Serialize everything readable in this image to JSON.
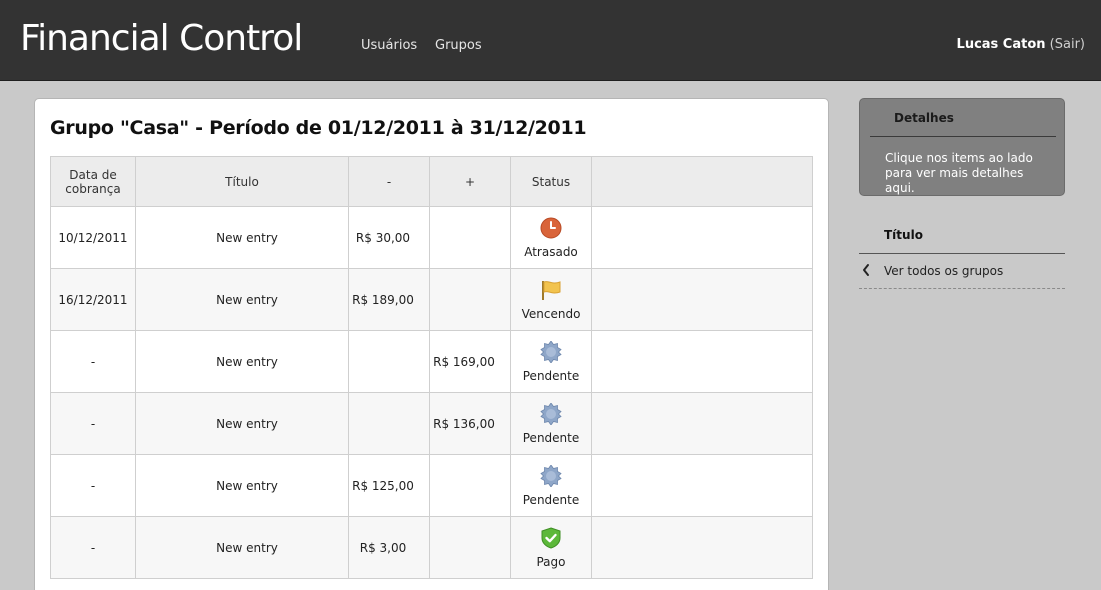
{
  "header": {
    "app_title": "Financial Control",
    "nav": [
      {
        "label": "Usuários"
      },
      {
        "label": "Grupos"
      }
    ],
    "user": {
      "name": "Lucas Caton",
      "logout": "(Sair)"
    }
  },
  "main": {
    "title": "Grupo \"Casa\" - Período de 01/12/2011 à 31/12/2011",
    "table": {
      "headers": {
        "date": "Data de cobrança",
        "title": "Título",
        "minus": "-",
        "plus": "+",
        "status": "Status",
        "extra": ""
      },
      "rows": [
        {
          "date": "10/12/2011",
          "title": "New entry",
          "minus": "R$ 30,00",
          "plus": "",
          "status": "Atrasado",
          "icon": "clock-icon"
        },
        {
          "date": "16/12/2011",
          "title": "New entry",
          "minus": "R$ 189,00",
          "plus": "",
          "status": "Vencendo",
          "icon": "flag-icon"
        },
        {
          "date": "-",
          "title": "New entry",
          "minus": "",
          "plus": "R$ 169,00",
          "status": "Pendente",
          "icon": "seal-icon"
        },
        {
          "date": "-",
          "title": "New entry",
          "minus": "",
          "plus": "R$ 136,00",
          "status": "Pendente",
          "icon": "seal-icon"
        },
        {
          "date": "-",
          "title": "New entry",
          "minus": "R$ 125,00",
          "plus": "",
          "status": "Pendente",
          "icon": "seal-icon"
        },
        {
          "date": "-",
          "title": "New entry",
          "minus": "R$ 3,00",
          "plus": "",
          "status": "Pago",
          "icon": "check-shield-icon"
        }
      ]
    }
  },
  "sidebar": {
    "details_title": "Detalhes",
    "details_text": "Clique nos items ao lado para ver mais detalhes aqui.",
    "section_title": "Título",
    "link": "Ver todos os grupos"
  },
  "colors": {
    "topbar": "#333333",
    "page_bg": "#c9c9c9",
    "details_box": "#808080",
    "status_late": "#d9643a",
    "status_due": "#f2c34e",
    "status_pending": "#8ea6c8",
    "status_paid": "#5cb83a"
  }
}
